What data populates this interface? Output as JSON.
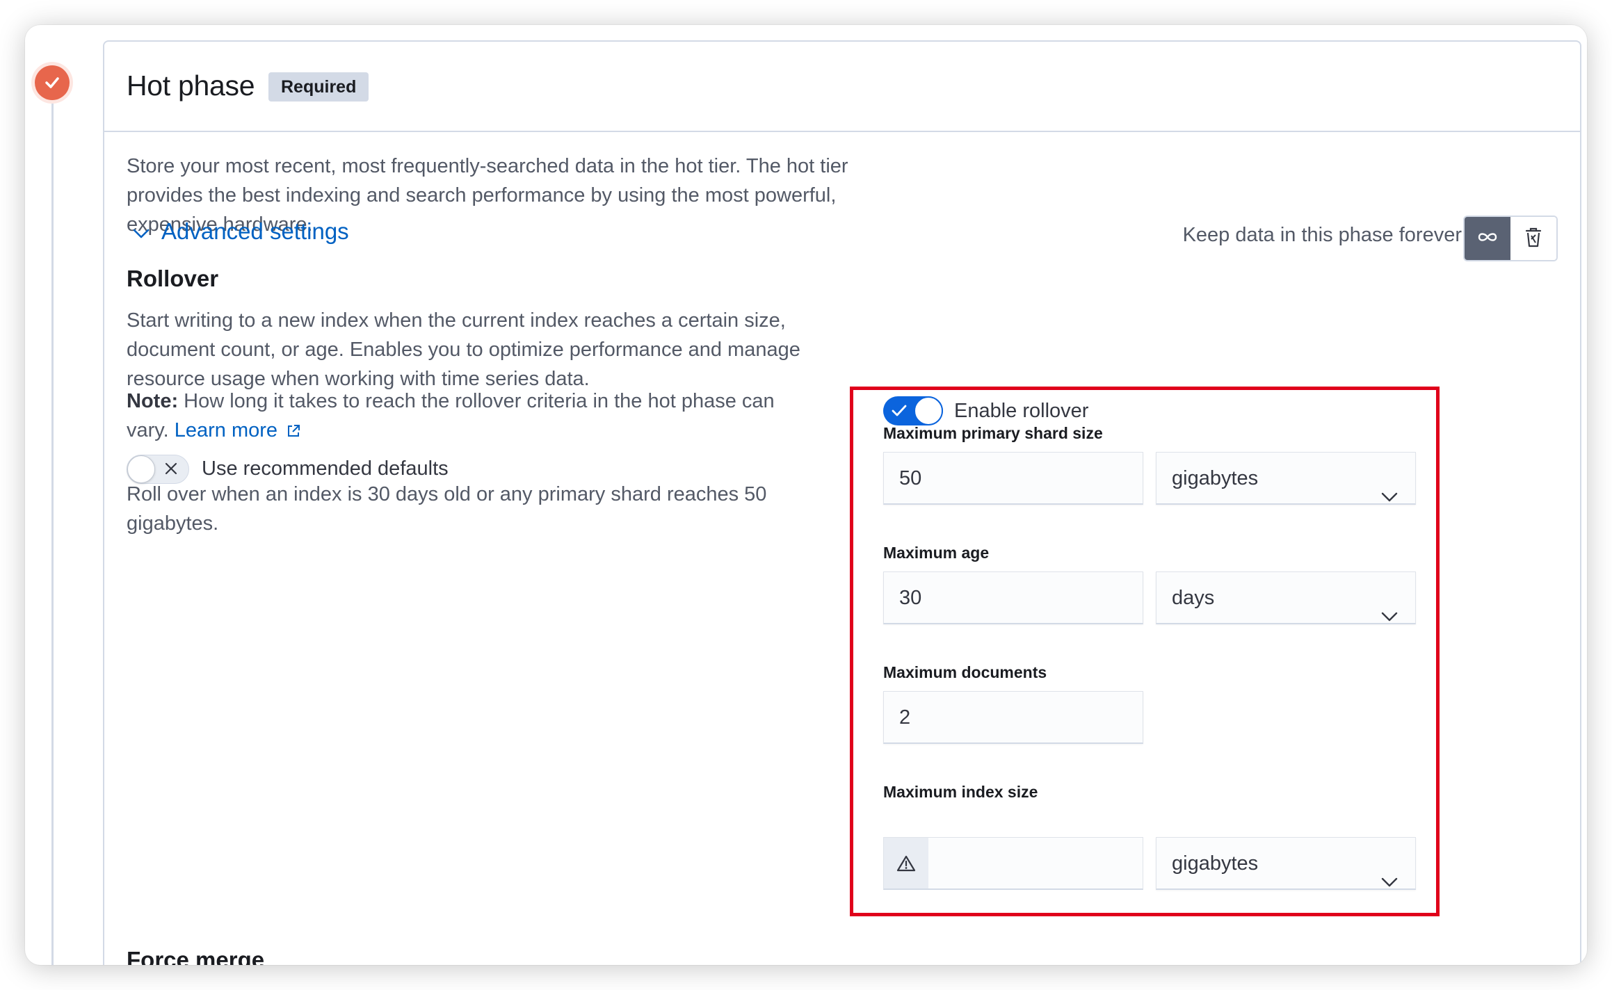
{
  "phase": {
    "title": "Hot phase",
    "badge": "Required",
    "description": "Store your most recent, most frequently-searched data in the hot tier. The hot tier provides the best indexing and search performance by using the most powerful, expensive hardware."
  },
  "advanced": {
    "label": "Advanced settings"
  },
  "keep": {
    "label": "Keep data in this phase forever"
  },
  "rollover": {
    "title": "Rollover",
    "description": "Start writing to a new index when the current index reaches a certain size, document count, or age. Enables you to optimize performance and manage resource usage when working with time series data.",
    "note_bold": "Note:",
    "note_text": " How long it takes to reach the rollover criteria in the hot phase can vary. ",
    "learn_more": "Learn more",
    "use_defaults_label": "Use recommended defaults",
    "use_defaults_on": false,
    "defaults_desc": "Roll over when an index is 30 days old or any primary shard reaches 50 gigabytes.",
    "enable_label": "Enable rollover",
    "enabled": true,
    "fields": {
      "shard_size_label": "Maximum primary shard size",
      "shard_size_value": "50",
      "shard_size_unit": "gigabytes",
      "max_age_label": "Maximum age",
      "max_age_value": "30",
      "max_age_unit": "days",
      "max_docs_label": "Maximum documents",
      "max_docs_value": "2",
      "index_size_label": "Maximum index size",
      "index_size_value": "",
      "index_size_unit": "gigabytes"
    }
  },
  "force_merge": {
    "title": "Force merge"
  },
  "colors": {
    "accent": "#0b64dd",
    "link": "#0061c2",
    "phase_dot": "#e7664c",
    "highlight": "#e0001b",
    "badge_bg": "#d3dae6"
  },
  "icons": {
    "phase_status": "check-icon",
    "advanced_toggle": "chevron-down-icon",
    "forever": "infinity-icon",
    "delete": "trash-icon",
    "external": "external-link-icon",
    "warning": "warning-icon"
  }
}
